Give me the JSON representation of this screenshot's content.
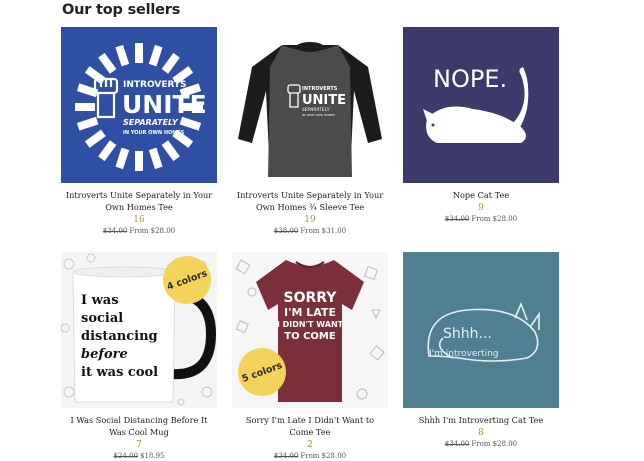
{
  "heading": "Our top sellers",
  "colors": {
    "count": "#b08a3a",
    "badge": "#f3d35a",
    "royal_blue": "#2e4fa3",
    "navy_purple": "#3b3a6b",
    "heather_teal": "#4f7f90",
    "maroon": "#7a2f3a"
  },
  "products": [
    {
      "title": "Introverts Unite Separately in Your Own Homes Tee",
      "count": "16",
      "old_price": "$34.00",
      "price": "From $28.00",
      "art": {
        "line1": "INTROVERTS",
        "line2": "UNITE",
        "line3": "SEPARATELY",
        "line4": "IN YOUR OWN HOMES",
        "icon": "raised-fist-icon"
      }
    },
    {
      "title": "Introverts Unite Separately in Your Own Homes ¾ Sleeve Tee",
      "count": "19",
      "old_price": "$38.00",
      "price": "From $31.00",
      "art": {
        "line1": "INTROVERTS",
        "line2": "UNITE",
        "line3": "SEPARATELY",
        "line4": "IN YOUR OWN HOMES",
        "icon": "raised-fist-icon"
      }
    },
    {
      "title": "Nope Cat Tee",
      "count": "9",
      "old_price": "$34.00",
      "price": "From $28.00",
      "art": {
        "text": "NOPE.",
        "icon": "lying-cat-icon"
      }
    },
    {
      "title": "I Was Social Distancing Before It Was Cool Mug",
      "count": "7",
      "old_price": "$24.00",
      "price": "$18.95",
      "art": {
        "lines": [
          "I was",
          "social",
          "distancing",
          "before",
          "it was cool"
        ],
        "badge": "4 colors",
        "icon": "mug-icon"
      }
    },
    {
      "title": "Sorry I'm Late I Didn't Want to Come Tee",
      "count": "2",
      "old_price": "$34.00",
      "price": "From $28.00",
      "art": {
        "line1": "SORRY",
        "line2": "I'M LATE",
        "line3": "I DIDN'T WANT",
        "line4": "TO COME",
        "badge": "5 colors",
        "icon": "tshirt-icon"
      }
    },
    {
      "title": "Shhh I'm Introverting Cat Tee",
      "count": "8",
      "old_price": "$34.00",
      "price": "From $28.00",
      "art": {
        "line1": "Shhh...",
        "line2": "I'm introverting",
        "icon": "sleeping-cat-icon"
      }
    }
  ]
}
